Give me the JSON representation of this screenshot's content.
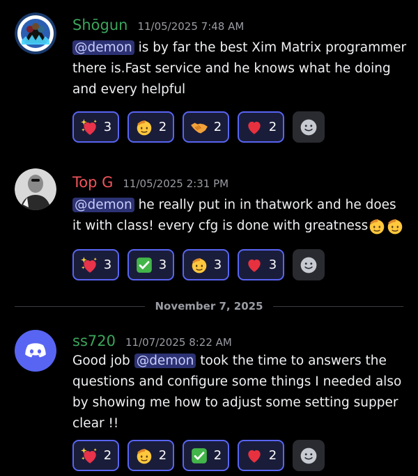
{
  "messages": [
    {
      "author": "Shōgun",
      "author_color": "#3ba55c",
      "timestamp": "11/05/2025 7:48 AM",
      "mention": "@demon",
      "text": " is by far the best Xim Matrix programmer there is.Fast service and he knows what he doing and every helpful",
      "reactions": [
        {
          "emoji": "sparkling-heart",
          "count": "3"
        },
        {
          "emoji": "saluting-face",
          "count": "2"
        },
        {
          "emoji": "handshake",
          "count": "2"
        },
        {
          "emoji": "red-heart",
          "count": "2"
        }
      ]
    },
    {
      "author": "Top G",
      "author_color": "#f0545c",
      "timestamp": "11/05/2025 2:31 PM",
      "mention": "@demon",
      "text": " he really put in in thatwork and he does it with class! every cfg is done with greatness",
      "reactions": [
        {
          "emoji": "sparkling-heart",
          "count": "3"
        },
        {
          "emoji": "check-mark",
          "count": "3"
        },
        {
          "emoji": "saluting-face",
          "count": "3"
        },
        {
          "emoji": "red-heart",
          "count": "3"
        }
      ]
    },
    {
      "author": "ss720",
      "author_color": "#3ba55c",
      "timestamp": "11/07/2025 8:22 AM",
      "pre_text": "Good job ",
      "mention": "@demon",
      "text": " took the time to answers the questions and configure some things I needed also by showing me how to adjust some setting supper clear !!",
      "reactions": [
        {
          "emoji": "sparkling-heart",
          "count": "2"
        },
        {
          "emoji": "saluting-face",
          "count": "2"
        },
        {
          "emoji": "check-mark",
          "count": "2"
        },
        {
          "emoji": "red-heart",
          "count": "2"
        }
      ]
    }
  ],
  "date_divider": "November 7, 2025"
}
